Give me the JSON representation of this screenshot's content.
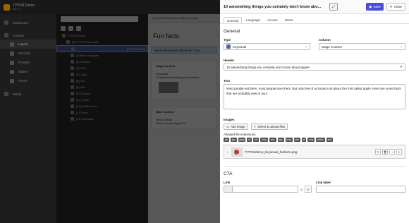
{
  "topbar": {
    "site_name": "TYPO3 Demo",
    "site_version": "Site 1.0"
  },
  "modules": [
    "Dashboard",
    "Content",
    "Layout",
    "Records",
    "Preview",
    "Status",
    "Forms",
    "Media"
  ],
  "tree": {
    "nodes": [
      "TYPO3 Demo",
      "[1] TYPO3 Demo Site",
      "[3] Fun Facts",
      "[4] Bites of apples",
      "[5] Recipes",
      "[6] FAQ",
      "[7] Login",
      "[8] 404",
      "[9] 403",
      "[10] Search",
      "[11] Footer",
      "[12] Profile Links",
      "[13] Blog",
      "[14] Sitemaps"
    ]
  },
  "content": {
    "crumb": "Layout  TYPO3 Demo Site  Fun Facts",
    "heading": "Fun facts",
    "info": "More information about the \"Fun",
    "col1_title": "Stage Content",
    "col1_ce": "Keyvisual",
    "col1_sub": "10 astonishing things you certainly...",
    "col2_title": "Main Content",
    "col2_ce": "Text & Media",
    "col2_sub": "Green, you're tagged in!"
  },
  "modal": {
    "title": "10 astonishing things you certainly don't know abo...",
    "save_label": "Save",
    "close_label": "Close",
    "tabs": [
      "General",
      "Language",
      "Access",
      "Notes"
    ],
    "section_general": "General",
    "type_label": "Type",
    "type_value": "Keyvisual",
    "column_label": "Column",
    "column_value": "Stage Content",
    "header_label": "Header",
    "header_value": "10 astonishing things you certainly don't know about apples",
    "text_label": "Text",
    "text_value": "Most people eat them, most people love them. But only few of us know a lot about the fruit called apple. Here are some facts that are probably new to you!",
    "images_label": "Images",
    "add_image": "Add image",
    "select_upload": "Select & upload files",
    "allowed_label": "Allowed file extensions",
    "extensions": [
      "gif",
      "jpg",
      "jpeg",
      "tif",
      "tiff",
      "bmp",
      "pcx",
      "tga",
      "png",
      "pdf",
      "ai",
      "svg",
      "webp",
      "avif"
    ],
    "file_name": "TYPO3demo_keyvisual_funfacts.png",
    "section_cta": "CTA",
    "link_label": "Link",
    "link_label_label": "Link label"
  }
}
